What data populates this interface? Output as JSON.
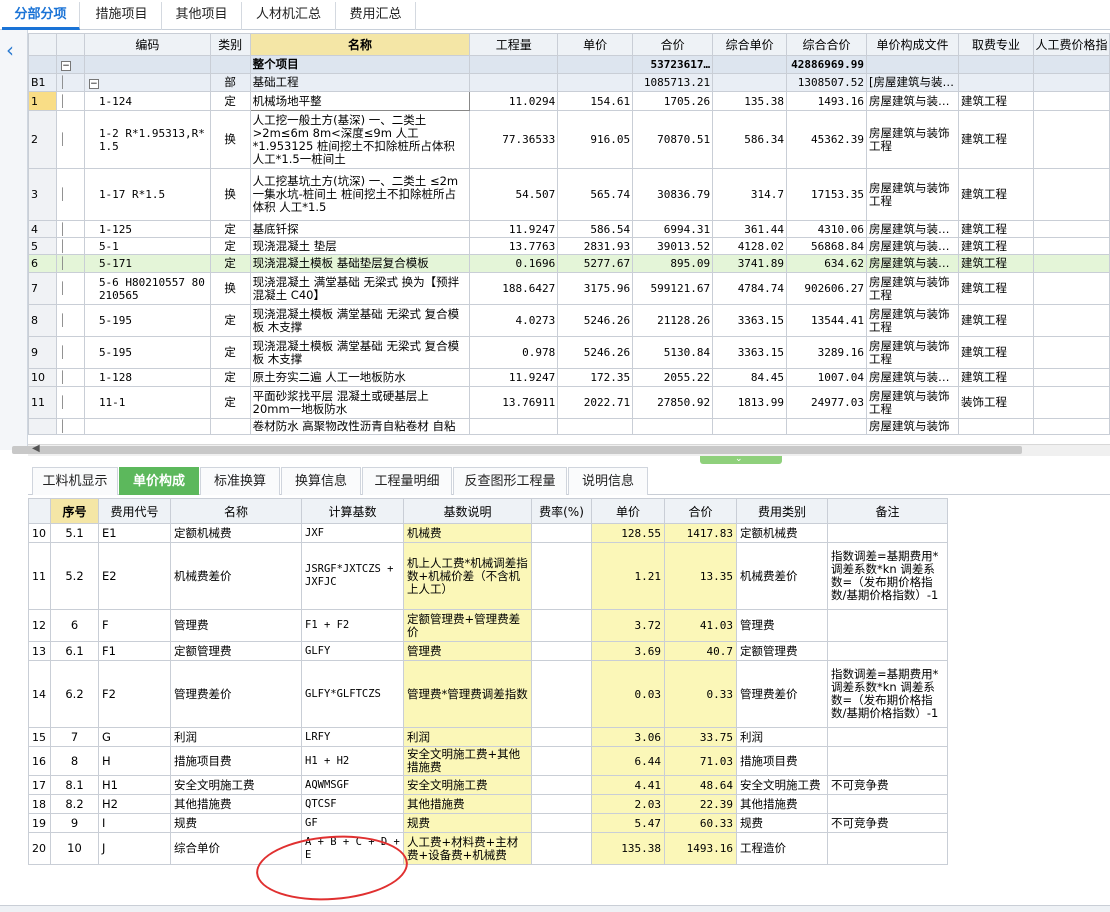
{
  "top_tabs": [
    "分部分项",
    "措施项目",
    "其他项目",
    "人材机汇总",
    "费用汇总"
  ],
  "main_table": {
    "headers": [
      "编码",
      "类别",
      "名称",
      "工程量",
      "单价",
      "合价",
      "综合单价",
      "综合合价",
      "单价构成文件",
      "取费专业",
      "人工费价格指"
    ],
    "total_row": {
      "name": "整个项目",
      "hejia": "53723617…",
      "zonghe_hejia": "42886969.99"
    },
    "group_row": {
      "id": "B1",
      "lb": "部",
      "name": "基础工程",
      "hejia": "1085713.21",
      "zonghe_hejia": "1308507.52",
      "file": "[房屋建筑与装…"
    },
    "rows": [
      {
        "no": "1",
        "code": "1-124",
        "lb": "定",
        "name": "机械场地平整",
        "qty": "11.0294",
        "price": "154.61",
        "hejia": "1705.26",
        "zhdj": "135.38",
        "zhhj": "1493.16",
        "file": "房屋建筑与装…",
        "major": "建筑工程"
      },
      {
        "no": "2",
        "code": "1-2 R*1.95313,R*1.5",
        "lb": "换",
        "name": "人工挖一般土方(基深) 一、二类土 >2m≤6m 8m<深度≤9m 人工*1.953125 桩间挖土不扣除桩所占体积 人工*1.5一桩间土",
        "qty": "77.36533",
        "price": "916.05",
        "hejia": "70870.51",
        "zhdj": "586.34",
        "zhhj": "45362.39",
        "file": "房屋建筑与装饰工程",
        "major": "建筑工程"
      },
      {
        "no": "3",
        "code": "1-17 R*1.5",
        "lb": "换",
        "name": "人工挖基坑土方(坑深) 一、二类土 ≤2m一集水坑-桩间土 桩间挖土不扣除桩所占体积 人工*1.5",
        "qty": "54.507",
        "price": "565.74",
        "hejia": "30836.79",
        "zhdj": "314.7",
        "zhhj": "17153.35",
        "file": "房屋建筑与装饰工程",
        "major": "建筑工程"
      },
      {
        "no": "4",
        "code": "1-125",
        "lb": "定",
        "name": "基底钎探",
        "qty": "11.9247",
        "price": "586.54",
        "hejia": "6994.31",
        "zhdj": "361.44",
        "zhhj": "4310.06",
        "file": "房屋建筑与装…",
        "major": "建筑工程"
      },
      {
        "no": "5",
        "code": "5-1",
        "lb": "定",
        "name": "现浇混凝土 垫层",
        "qty": "13.7763",
        "price": "2831.93",
        "hejia": "39013.52",
        "zhdj": "4128.02",
        "zhhj": "56868.84",
        "file": "房屋建筑与装…",
        "major": "建筑工程"
      },
      {
        "no": "6",
        "code": "5-171",
        "lb": "定",
        "name": "现浇混凝土模板 基础垫层复合模板",
        "qty": "0.1696",
        "price": "5277.67",
        "hejia": "895.09",
        "zhdj": "3741.89",
        "zhhj": "634.62",
        "file": "房屋建筑与装…",
        "major": "建筑工程"
      },
      {
        "no": "7",
        "code": "5-6 H80210557 80210565",
        "lb": "换",
        "name": "现浇混凝土 满堂基础 无梁式 换为【预拌混凝土 C40】",
        "qty": "188.6427",
        "price": "3175.96",
        "hejia": "599121.67",
        "zhdj": "4784.74",
        "zhhj": "902606.27",
        "file": "房屋建筑与装饰工程",
        "major": "建筑工程"
      },
      {
        "no": "8",
        "code": "5-195",
        "lb": "定",
        "name": "现浇混凝土模板 满堂基础 无梁式 复合模板 木支撑",
        "qty": "4.0273",
        "price": "5246.26",
        "hejia": "21128.26",
        "zhdj": "3363.15",
        "zhhj": "13544.41",
        "file": "房屋建筑与装饰工程",
        "major": "建筑工程"
      },
      {
        "no": "9",
        "code": "5-195",
        "lb": "定",
        "name": "现浇混凝土模板 满堂基础 无梁式 复合模板 木支撑",
        "qty": "0.978",
        "price": "5246.26",
        "hejia": "5130.84",
        "zhdj": "3363.15",
        "zhhj": "3289.16",
        "file": "房屋建筑与装饰工程",
        "major": "建筑工程"
      },
      {
        "no": "10",
        "code": "1-128",
        "lb": "定",
        "name": "原土夯实二遍 人工一地板防水",
        "qty": "11.9247",
        "price": "172.35",
        "hejia": "2055.22",
        "zhdj": "84.45",
        "zhhj": "1007.04",
        "file": "房屋建筑与装…",
        "major": "建筑工程"
      },
      {
        "no": "11",
        "code": "11-1",
        "lb": "定",
        "name": "平面砂浆找平层 混凝土或硬基层上 20mm一地板防水",
        "qty": "13.76911",
        "price": "2022.71",
        "hejia": "27850.92",
        "zhdj": "1813.99",
        "zhhj": "24977.03",
        "file": "房屋建筑与装饰工程",
        "major": "装饰工程"
      },
      {
        "no": "",
        "code": "",
        "lb": "",
        "name": "卷材防水 高聚物改性沥青自粘卷材 自粘",
        "qty": "",
        "price": "",
        "hejia": "",
        "zhdj": "",
        "zhhj": "",
        "file": "房屋建筑与装饰",
        "major": ""
      }
    ]
  },
  "sub_tabs": [
    "工料机显示",
    "单价构成",
    "标准换算",
    "换算信息",
    "工程量明细",
    "反查图形工程量",
    "说明信息"
  ],
  "detail_table": {
    "headers": [
      "序号",
      "费用代号",
      "名称",
      "计算基数",
      "基数说明",
      "费率(%)",
      "单价",
      "合价",
      "费用类别",
      "备注"
    ],
    "rows": [
      {
        "no": "10",
        "seq": "5.1",
        "code": "E1",
        "name": "定额机械费",
        "base": "JXF",
        "desc": "机械费",
        "rate": "",
        "price": "128.55",
        "total": "1417.83",
        "type": "定额机械费",
        "note": ""
      },
      {
        "no": "11",
        "seq": "5.2",
        "code": "E2",
        "name": "机械费差价",
        "base": "JSRGF*JXTCZS + JXFJC",
        "desc": "机上人工费*机械调差指数+机械价差（不含机上人工）",
        "rate": "",
        "price": "1.21",
        "total": "13.35",
        "type": "机械费差价",
        "note": "指数调差=基期费用*调差系数*kn 调差系数=（发布期价格指数/基期价格指数）-1"
      },
      {
        "no": "12",
        "seq": "6",
        "code": "F",
        "name": "管理费",
        "base": "F1 + F2",
        "desc": "定额管理费+管理费差价",
        "rate": "",
        "price": "3.72",
        "total": "41.03",
        "type": "管理费",
        "note": ""
      },
      {
        "no": "13",
        "seq": "6.1",
        "code": "F1",
        "name": "定额管理费",
        "base": "GLFY",
        "desc": "管理费",
        "rate": "",
        "price": "3.69",
        "total": "40.7",
        "type": "定额管理费",
        "note": ""
      },
      {
        "no": "14",
        "seq": "6.2",
        "code": "F2",
        "name": "管理费差价",
        "base": "GLFY*GLFTCZS",
        "desc": "管理费*管理费调差指数",
        "rate": "",
        "price": "0.03",
        "total": "0.33",
        "type": "管理费差价",
        "note": "指数调差=基期费用*调差系数*kn 调差系数=（发布期价格指数/基期价格指数）-1"
      },
      {
        "no": "15",
        "seq": "7",
        "code": "G",
        "name": "利润",
        "base": "LRFY",
        "desc": "利润",
        "rate": "",
        "price": "3.06",
        "total": "33.75",
        "type": "利润",
        "note": ""
      },
      {
        "no": "16",
        "seq": "8",
        "code": "H",
        "name": "措施项目费",
        "base": "H1 + H2",
        "desc": "安全文明施工费+其他措施费",
        "rate": "",
        "price": "6.44",
        "total": "71.03",
        "type": "措施项目费",
        "note": ""
      },
      {
        "no": "17",
        "seq": "8.1",
        "code": "H1",
        "name": "安全文明施工费",
        "base": "AQWMSGF",
        "desc": "安全文明施工费",
        "rate": "",
        "price": "4.41",
        "total": "48.64",
        "type": "安全文明施工费",
        "note": "不可竞争费"
      },
      {
        "no": "18",
        "seq": "8.2",
        "code": "H2",
        "name": "其他措施费",
        "base": "QTCSF",
        "desc": "其他措施费",
        "rate": "",
        "price": "2.03",
        "total": "22.39",
        "type": "其他措施费",
        "note": ""
      },
      {
        "no": "19",
        "seq": "9",
        "code": "I",
        "name": "规费",
        "base": "GF",
        "desc": "规费",
        "rate": "",
        "price": "5.47",
        "total": "60.33",
        "type": "规费",
        "note": "不可竞争费"
      },
      {
        "no": "20",
        "seq": "10",
        "code": "J",
        "name": "综合单价",
        "base": "A + B + C + D + E",
        "desc": "人工费+材料费+主材费+设备费+机械费",
        "rate": "",
        "price": "135.38",
        "total": "1493.16",
        "type": "工程造价",
        "note": ""
      }
    ]
  }
}
